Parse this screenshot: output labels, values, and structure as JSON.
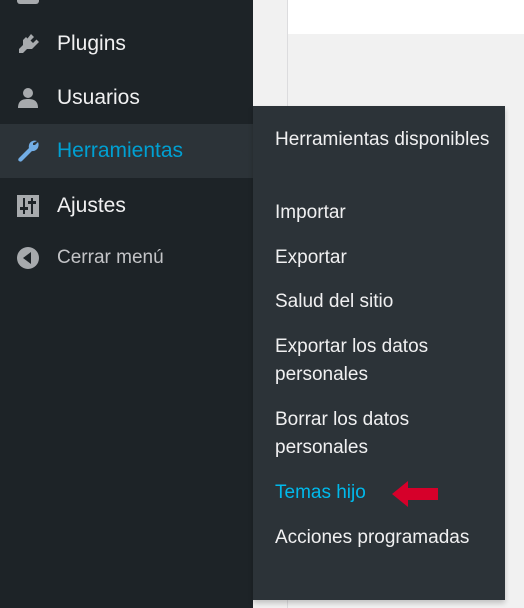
{
  "sidebar": {
    "items": [
      {
        "label": "Plugins",
        "icon": "plug-icon"
      },
      {
        "label": "Usuarios",
        "icon": "user-icon"
      },
      {
        "label": "Herramientas",
        "icon": "wrench-icon",
        "active": true
      },
      {
        "label": "Ajustes",
        "icon": "sliders-icon"
      },
      {
        "label": "Cerrar menú",
        "icon": "collapse-circle-icon"
      }
    ]
  },
  "flyout": {
    "items": [
      {
        "label": "Herramientas disponibles"
      },
      {
        "label": "Importar"
      },
      {
        "label": "Exportar"
      },
      {
        "label": "Salud del sitio"
      },
      {
        "label": "Exportar los datos personales"
      },
      {
        "label": "Borrar los datos personales"
      },
      {
        "label": "Temas hijo",
        "current": true
      },
      {
        "label": "Acciones programadas"
      }
    ]
  },
  "colors": {
    "sidebar_bg": "#1d2327",
    "flyout_bg": "#2c3338",
    "accent": "#00a0d2",
    "arrow": "#d6002a"
  }
}
